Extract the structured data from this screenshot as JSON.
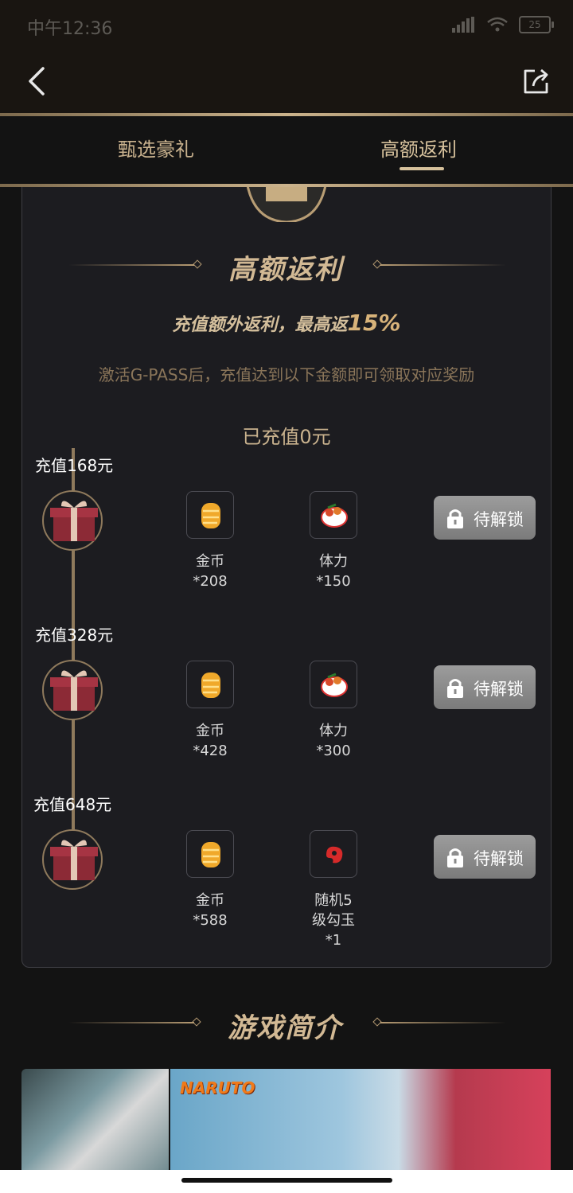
{
  "status": {
    "time": "中午12:36",
    "battery": "25"
  },
  "tabs": [
    {
      "label": "甄选豪礼"
    },
    {
      "label": "高额返利"
    }
  ],
  "rebate": {
    "title": "高额返利",
    "subtitle_prefix": "充值额外返利，最高返",
    "subtitle_pct": "15%",
    "description": "激活G-PASS后，充值达到以下金额即可领取对应奖励",
    "charged": "已充值0元",
    "tiers": [
      {
        "label": "充值168元",
        "rewards": [
          {
            "name": "金币",
            "qty": "*208"
          },
          {
            "name": "体力",
            "qty": "*150"
          }
        ],
        "button": "待解锁"
      },
      {
        "label": "充值328元",
        "rewards": [
          {
            "name": "金币",
            "qty": "*428"
          },
          {
            "name": "体力",
            "qty": "*300"
          }
        ],
        "button": "待解锁"
      },
      {
        "label": "充值648元",
        "rewards": [
          {
            "name": "金币",
            "qty": "*588"
          },
          {
            "name": "随机5",
            "name2": "级勾玉",
            "qty": "*1"
          }
        ],
        "button": "待解锁"
      }
    ]
  },
  "intro": {
    "title": "游戏简介",
    "banner_logo": "NARUTO"
  },
  "colors": {
    "gold": "#d2b994",
    "button_gray": "#8a8a8a"
  }
}
